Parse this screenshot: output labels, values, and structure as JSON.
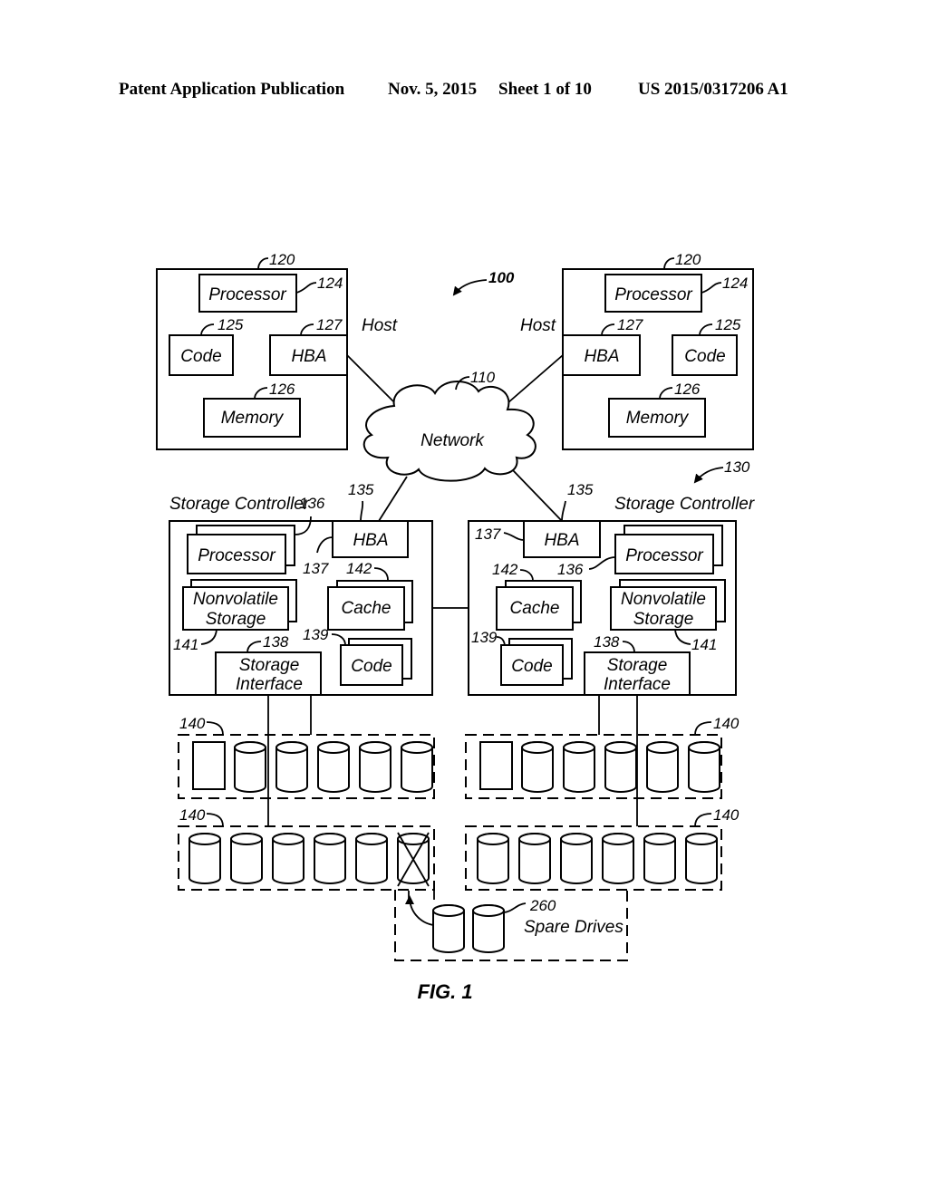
{
  "header": {
    "publication": "Patent Application Publication",
    "date": "Nov. 5, 2015",
    "sheet": "Sheet 1 of 10",
    "number": "US 2015/0317206 A1"
  },
  "figure": {
    "system_ref": "100",
    "caption": "FIG. 1",
    "network": {
      "label": "Network",
      "ref": "110"
    },
    "hosts": [
      {
        "title": "Host",
        "ref": "120",
        "processor": {
          "label": "Processor",
          "ref": "124"
        },
        "code": {
          "label": "Code",
          "ref": "125"
        },
        "hba": {
          "label": "HBA",
          "ref": "127"
        },
        "memory": {
          "label": "Memory",
          "ref": "126"
        }
      },
      {
        "title": "Host",
        "ref": "120",
        "processor": {
          "label": "Processor",
          "ref": "124"
        },
        "code": {
          "label": "Code",
          "ref": "125"
        },
        "hba": {
          "label": "HBA",
          "ref": "127"
        },
        "memory": {
          "label": "Memory",
          "ref": "126"
        }
      }
    ],
    "controllers_ref": "130",
    "controllers": [
      {
        "title": "Storage Controller",
        "hba": {
          "label": "HBA",
          "ref": "135",
          "ref2": "137"
        },
        "processor": {
          "label": "Processor",
          "ref": "136"
        },
        "nvs": {
          "line1": "Nonvolatile",
          "line2": "Storage",
          "ref": "141"
        },
        "cache": {
          "label": "Cache",
          "ref": "142"
        },
        "code": {
          "label": "Code",
          "ref": "139"
        },
        "storage_interface": {
          "line1": "Storage",
          "line2": "Interface",
          "ref": "138"
        }
      },
      {
        "title": "Storage Controller",
        "hba": {
          "label": "HBA",
          "ref": "135",
          "ref2": "137"
        },
        "processor": {
          "label": "Processor",
          "ref": "136"
        },
        "nvs": {
          "line1": "Nonvolatile",
          "line2": "Storage",
          "ref": "141"
        },
        "cache": {
          "label": "Cache",
          "ref": "142"
        },
        "code": {
          "label": "Code",
          "ref": "139"
        },
        "storage_interface": {
          "line1": "Storage",
          "line2": "Interface",
          "ref": "138"
        }
      }
    ],
    "arrays": [
      {
        "ref": "140",
        "position": "top-left",
        "drives": [
          "module",
          "disk",
          "disk",
          "disk",
          "disk",
          "disk"
        ]
      },
      {
        "ref": "140",
        "position": "top-right",
        "drives": [
          "module",
          "disk",
          "disk",
          "disk",
          "disk",
          "disk"
        ]
      },
      {
        "ref": "140",
        "position": "bottom-left",
        "drives": [
          "disk",
          "disk",
          "disk",
          "disk",
          "disk",
          "failed-disk"
        ]
      },
      {
        "ref": "140",
        "position": "bottom-right",
        "drives": [
          "disk",
          "disk",
          "disk",
          "disk",
          "disk",
          "disk"
        ]
      }
    ],
    "spares": {
      "label": "Spare Drives",
      "ref": "260",
      "count": 2
    }
  }
}
